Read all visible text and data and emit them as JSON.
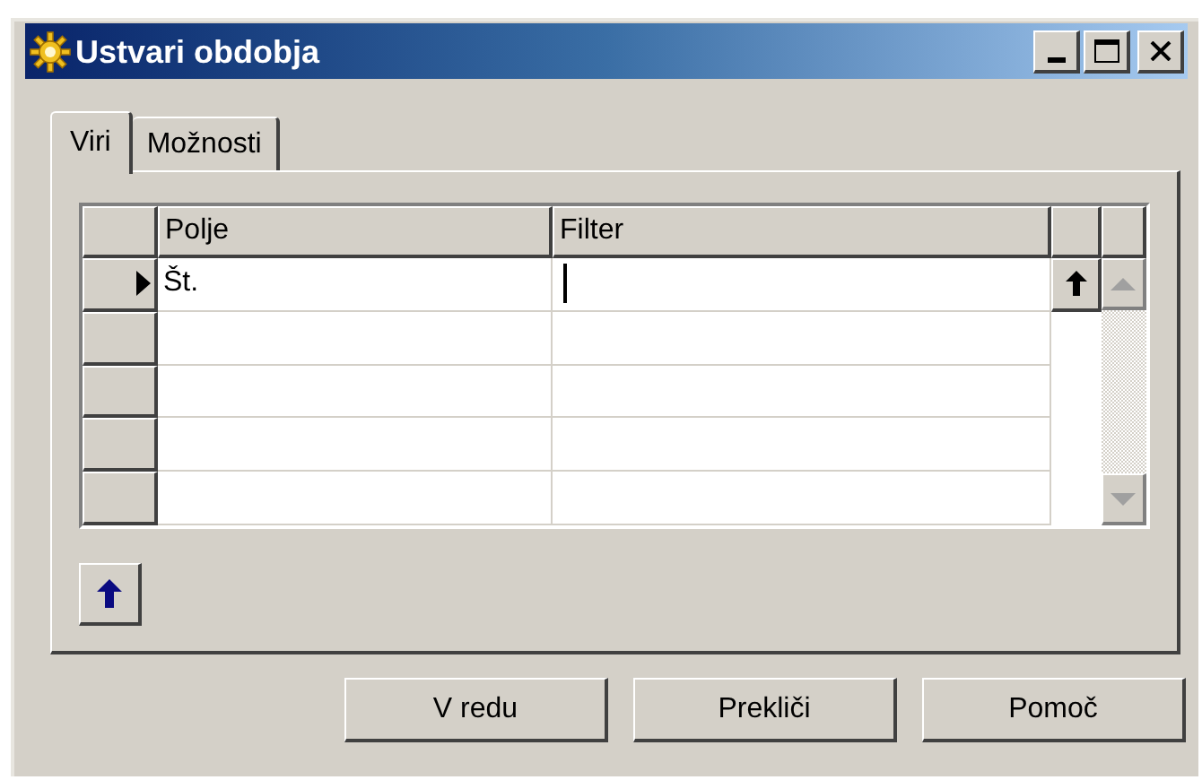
{
  "window": {
    "title": "Ustvari obdobja"
  },
  "tabs": [
    {
      "label": "Viri",
      "selected": true
    },
    {
      "label": "Možnosti",
      "selected": false
    }
  ],
  "grid": {
    "columns": [
      "Polje",
      "Filter"
    ],
    "rows": [
      {
        "field": "Št.",
        "current": true
      },
      {
        "current": false
      },
      {
        "current": false
      },
      {
        "current": false
      },
      {
        "current": false
      }
    ]
  },
  "buttons": [
    "V redu",
    "Prekliči",
    "Pomoč"
  ]
}
